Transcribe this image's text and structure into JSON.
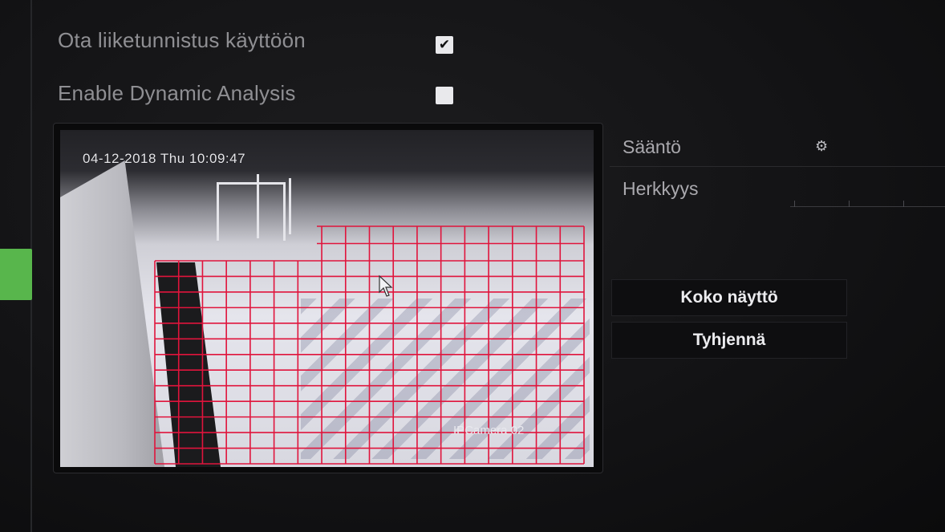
{
  "options": {
    "motion_detection": {
      "label": "Ota liiketunnistus käyttöön",
      "checked": true
    },
    "dynamic_analysis": {
      "label": "Enable Dynamic Analysis",
      "checked": false
    }
  },
  "video": {
    "timestamp": "04-12-2018 Thu 10:09:47",
    "camera_label": "IPCamera 02",
    "grid_color": "#e0143c"
  },
  "settings": {
    "rule_label": "Sääntö",
    "sensitivity_label": "Herkkyys"
  },
  "buttons": {
    "fullscreen": "Koko näyttö",
    "clear": "Tyhjennä"
  },
  "colors": {
    "accent_tab": "#58b64c",
    "background": "#131315"
  }
}
